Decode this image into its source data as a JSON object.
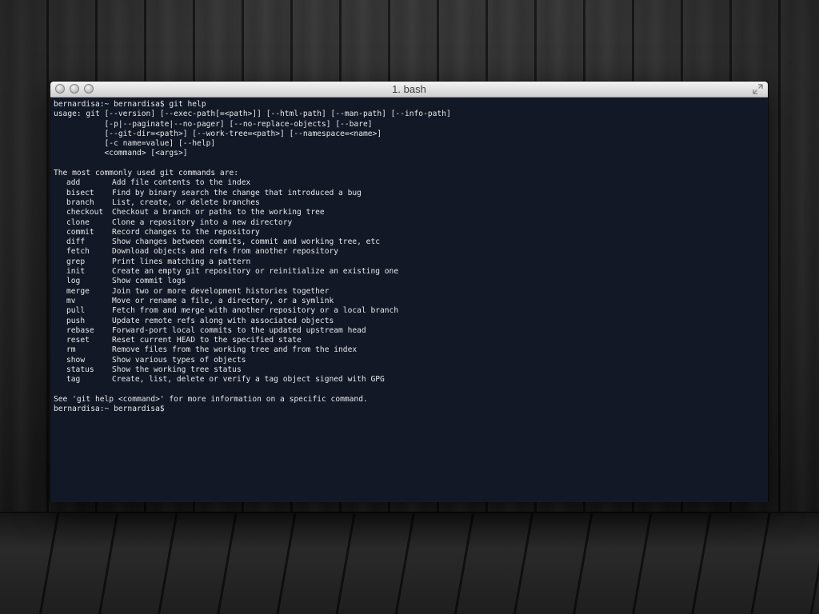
{
  "window": {
    "title": "1. bash"
  },
  "terminal": {
    "prompt_command": "bernardisa:~ bernardisa$ git help",
    "usage_lines": [
      "usage: git [--version] [--exec-path[=<path>]] [--html-path] [--man-path] [--info-path]",
      "           [-p|--paginate|--no-pager] [--no-replace-objects] [--bare]",
      "           [--git-dir=<path>] [--work-tree=<path>] [--namespace=<name>]",
      "           [-c name=value] [--help]",
      "           <command> [<args>]"
    ],
    "commands_heading": "The most commonly used git commands are:",
    "commands": [
      {
        "name": "add",
        "desc": "Add file contents to the index"
      },
      {
        "name": "bisect",
        "desc": "Find by binary search the change that introduced a bug"
      },
      {
        "name": "branch",
        "desc": "List, create, or delete branches"
      },
      {
        "name": "checkout",
        "desc": "Checkout a branch or paths to the working tree"
      },
      {
        "name": "clone",
        "desc": "Clone a repository into a new directory"
      },
      {
        "name": "commit",
        "desc": "Record changes to the repository"
      },
      {
        "name": "diff",
        "desc": "Show changes between commits, commit and working tree, etc"
      },
      {
        "name": "fetch",
        "desc": "Download objects and refs from another repository"
      },
      {
        "name": "grep",
        "desc": "Print lines matching a pattern"
      },
      {
        "name": "init",
        "desc": "Create an empty git repository or reinitialize an existing one"
      },
      {
        "name": "log",
        "desc": "Show commit logs"
      },
      {
        "name": "merge",
        "desc": "Join two or more development histories together"
      },
      {
        "name": "mv",
        "desc": "Move or rename a file, a directory, or a symlink"
      },
      {
        "name": "pull",
        "desc": "Fetch from and merge with another repository or a local branch"
      },
      {
        "name": "push",
        "desc": "Update remote refs along with associated objects"
      },
      {
        "name": "rebase",
        "desc": "Forward-port local commits to the updated upstream head"
      },
      {
        "name": "reset",
        "desc": "Reset current HEAD to the specified state"
      },
      {
        "name": "rm",
        "desc": "Remove files from the working tree and from the index"
      },
      {
        "name": "show",
        "desc": "Show various types of objects"
      },
      {
        "name": "status",
        "desc": "Show the working tree status"
      },
      {
        "name": "tag",
        "desc": "Create, list, delete or verify a tag object signed with GPG"
      }
    ],
    "footer": "See 'git help <command>' for more information on a specific command.",
    "final_prompt": "bernardisa:~ bernardisa$"
  }
}
